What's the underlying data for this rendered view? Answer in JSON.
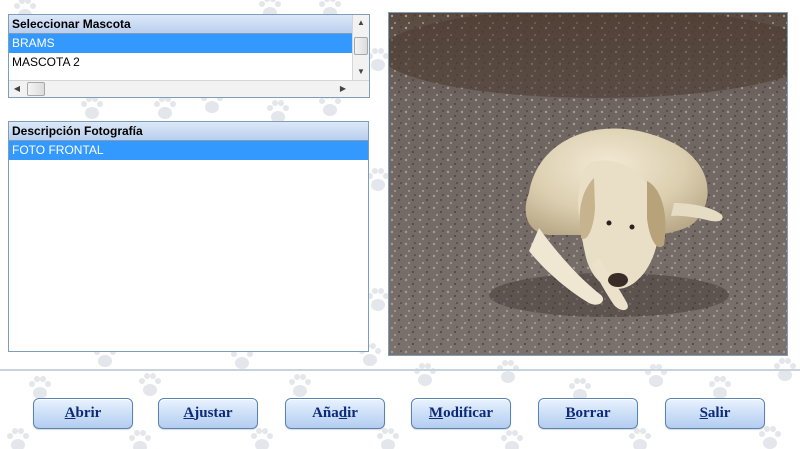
{
  "mascotas": {
    "header": "Seleccionar Mascota",
    "items": [
      {
        "label": "BRAMS",
        "selected": true
      },
      {
        "label": "MASCOTA 2",
        "selected": false
      }
    ]
  },
  "fotos": {
    "header": "Descripción Fotografía",
    "items": [
      {
        "label": "FOTO FRONTAL",
        "selected": true
      }
    ]
  },
  "buttons": [
    {
      "name": "abrir-button",
      "accel": "A",
      "rest": "brir"
    },
    {
      "name": "ajustar-button",
      "accel": "A",
      "rest": "justar"
    },
    {
      "name": "anadir-button",
      "pre": "Aña",
      "accel": "d",
      "rest": "ir"
    },
    {
      "name": "modificar-button",
      "accel": "M",
      "rest": "odificar"
    },
    {
      "name": "borrar-button",
      "accel": "B",
      "rest": "orrar"
    },
    {
      "name": "salir-button",
      "accel": "S",
      "rest": "alir"
    }
  ],
  "colors": {
    "selection": "#3399ff",
    "header_bg": "#c7d9f2",
    "button_text": "#0d2a78",
    "panel_border": "#7f9db9"
  },
  "icons": {
    "background": "paw-print-icon",
    "scroll_up": "arrow-up-icon",
    "scroll_down": "arrow-down-icon",
    "scroll_left": "arrow-left-icon",
    "scroll_right": "arrow-right-icon"
  }
}
